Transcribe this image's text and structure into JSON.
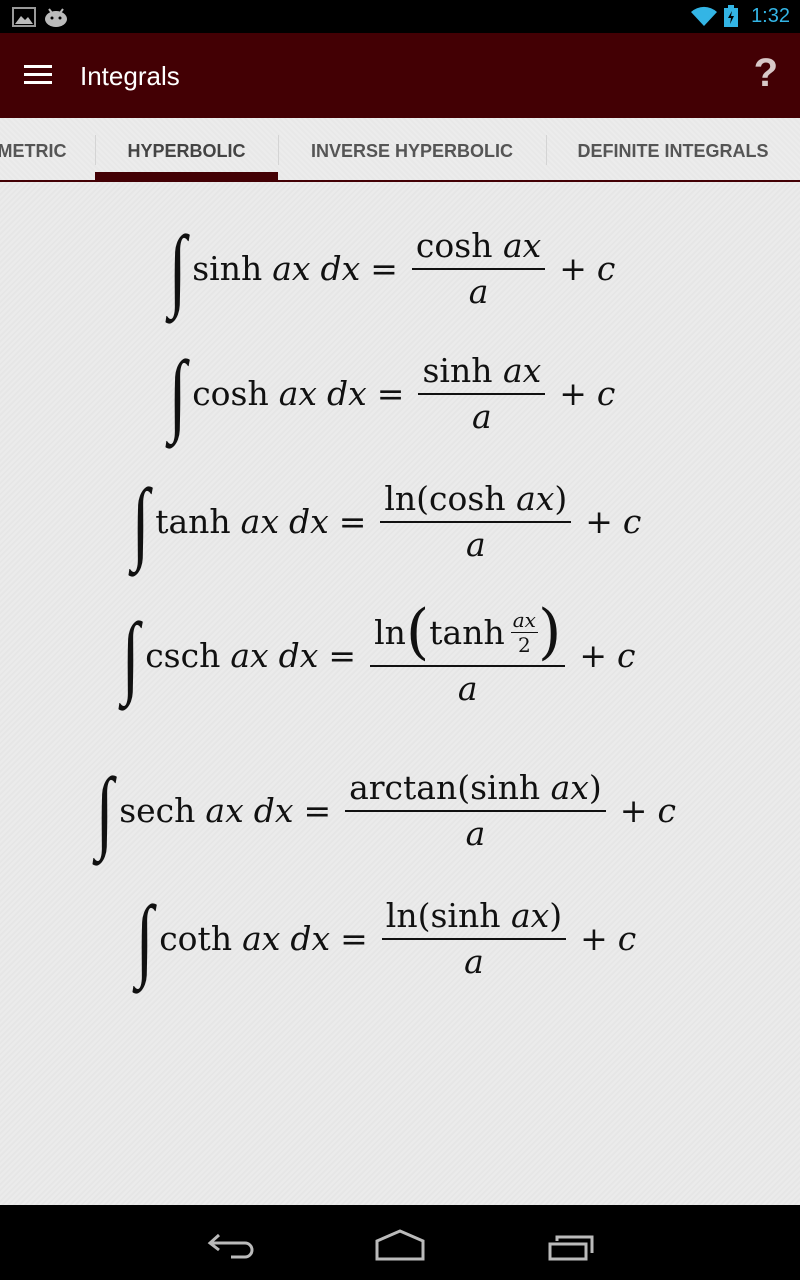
{
  "status_bar": {
    "time": "1:32",
    "left_icons": [
      "gallery-notification-icon",
      "android-notification-icon"
    ],
    "right_icons": [
      "wifi-icon",
      "battery-charging-icon"
    ]
  },
  "app_bar": {
    "title": "Integrals",
    "menu_icon": "hamburger-menu-icon",
    "help_label": "?"
  },
  "tabs": [
    {
      "label": "METRIC",
      "active": false
    },
    {
      "label": "HYPERBOLIC",
      "active": true
    },
    {
      "label": "INVERSE HYPERBOLIC",
      "active": false
    },
    {
      "label": "DEFINITE INTEGRALS",
      "active": false
    }
  ],
  "formulas": [
    {
      "fn": "sinh",
      "var": "ax",
      "d": "dx",
      "num_fn": "cosh",
      "num_arg": "ax",
      "den": "a",
      "const": "c"
    },
    {
      "fn": "cosh",
      "var": "ax",
      "d": "dx",
      "num_fn": "sinh",
      "num_arg": "ax",
      "den": "a",
      "const": "c"
    },
    {
      "fn": "tanh",
      "var": "ax",
      "d": "dx",
      "num_outer": "ln(",
      "num_fn": "cosh",
      "num_arg": "ax",
      "num_close": ")",
      "den": "a",
      "const": "c"
    },
    {
      "fn": "csch",
      "var": "ax",
      "d": "dx",
      "num_outer": "ln",
      "num_fn": "tanh",
      "num_frac_top": "ax",
      "num_frac_bottom": "2",
      "den": "a",
      "const": "c"
    },
    {
      "fn": "sech",
      "var": "ax",
      "d": "dx",
      "num_outer": "arctan(",
      "num_fn": "sinh",
      "num_arg": "ax",
      "num_close": ")",
      "den": "a",
      "const": "c"
    },
    {
      "fn": "coth",
      "var": "ax",
      "d": "dx",
      "num_outer": "ln(",
      "num_fn": "sinh",
      "num_arg": "ax",
      "num_close": ")",
      "den": "a",
      "const": "c"
    }
  ],
  "symbols": {
    "integral": "∫",
    "equals": "=",
    "plus": "+",
    "lparen": "(",
    "rparen": ")"
  },
  "nav_bar": {
    "buttons": [
      "back",
      "home",
      "recent-apps"
    ]
  },
  "colors": {
    "app_bar": "#430004",
    "status_time": "#33b5e5",
    "background": "#ebebeb"
  }
}
